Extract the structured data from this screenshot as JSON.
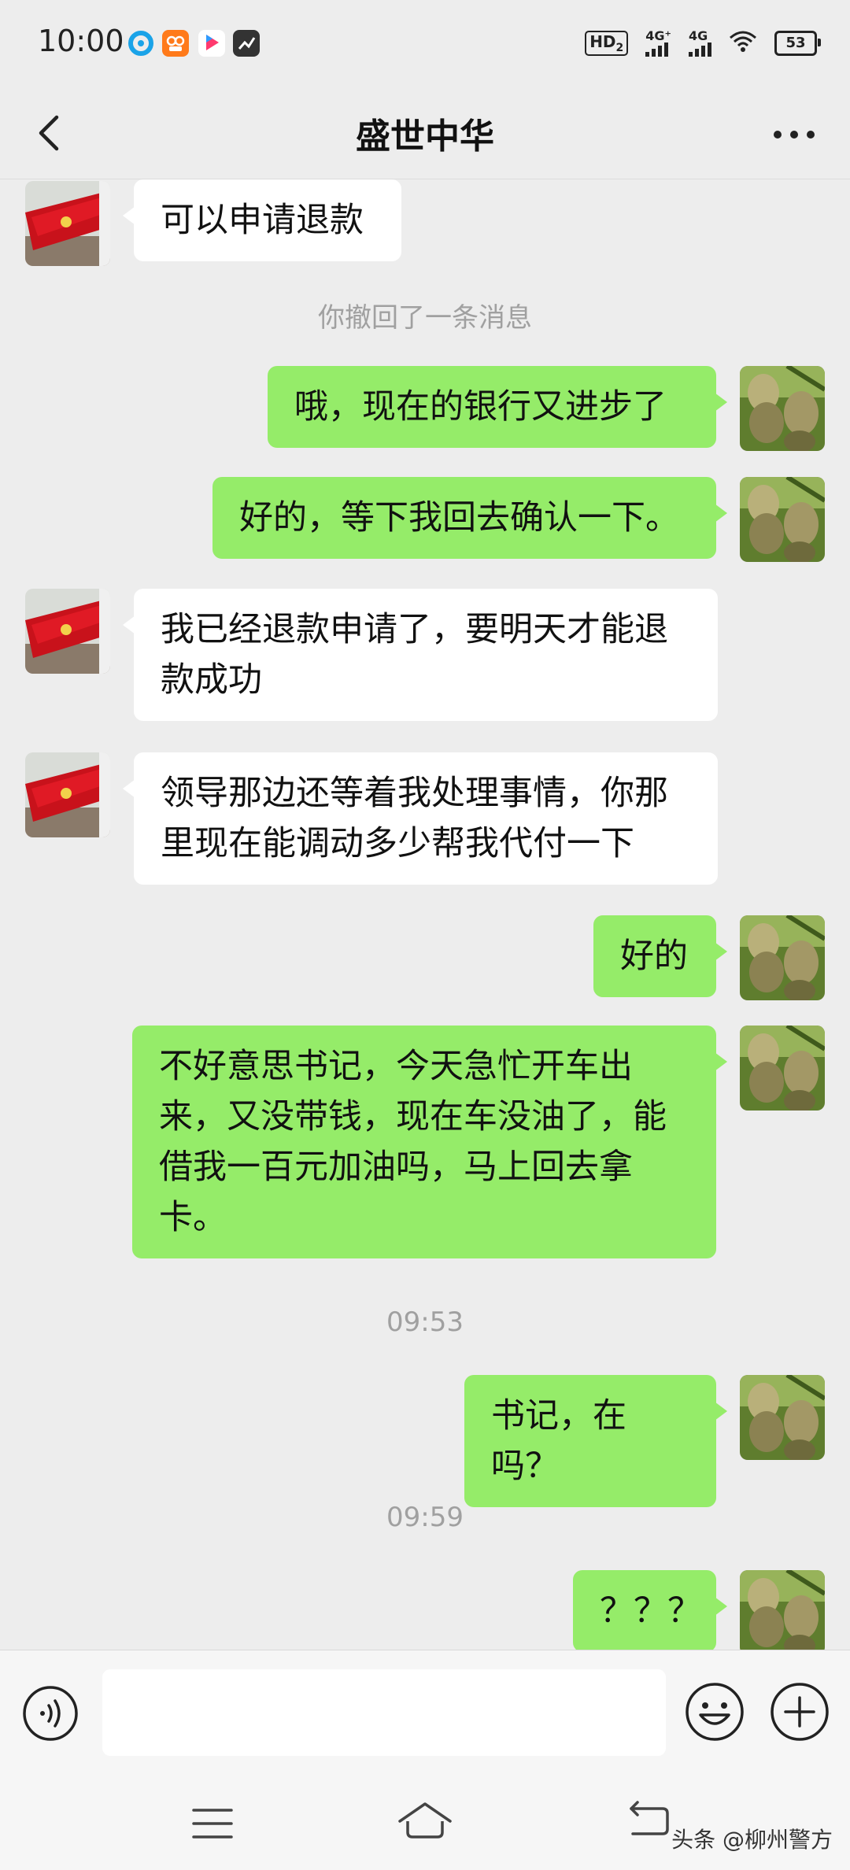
{
  "status_bar": {
    "time": "10:00",
    "hd_label": "HD",
    "hd_sub": "2",
    "signal1_label": "4G⁺",
    "signal2_label": "4G",
    "battery": "53"
  },
  "header": {
    "title": "盛世中华"
  },
  "messages": [
    {
      "side": "in",
      "text": "可以申请退款"
    },
    {
      "side": "system",
      "text": "你撤回了一条消息"
    },
    {
      "side": "out",
      "text": "哦，现在的银行又进步了"
    },
    {
      "side": "out",
      "text": "好的，等下我回去确认一下。"
    },
    {
      "side": "in",
      "text": "我已经退款申请了，要明天才能退款成功"
    },
    {
      "side": "in",
      "text": "领导那边还等着我处理事情，你那里现在能调动多少帮我代付一下"
    },
    {
      "side": "out",
      "text": "好的"
    },
    {
      "side": "out",
      "text": "不好意思书记，今天急忙开车出来，又没带钱，现在车没油了，能借我一百元加油吗，马上回去拿卡。"
    },
    {
      "side": "time",
      "text": "09:53"
    },
    {
      "side": "out",
      "text": "书记，在吗？"
    },
    {
      "side": "time",
      "text": "09:59"
    },
    {
      "side": "out",
      "text": "？？？"
    }
  ],
  "input": {
    "value": "",
    "placeholder": ""
  },
  "watermark": "头条 @柳州警方",
  "colors": {
    "background": "#ededed",
    "bubble_out": "#95ec69",
    "bubble_in": "#ffffff"
  }
}
